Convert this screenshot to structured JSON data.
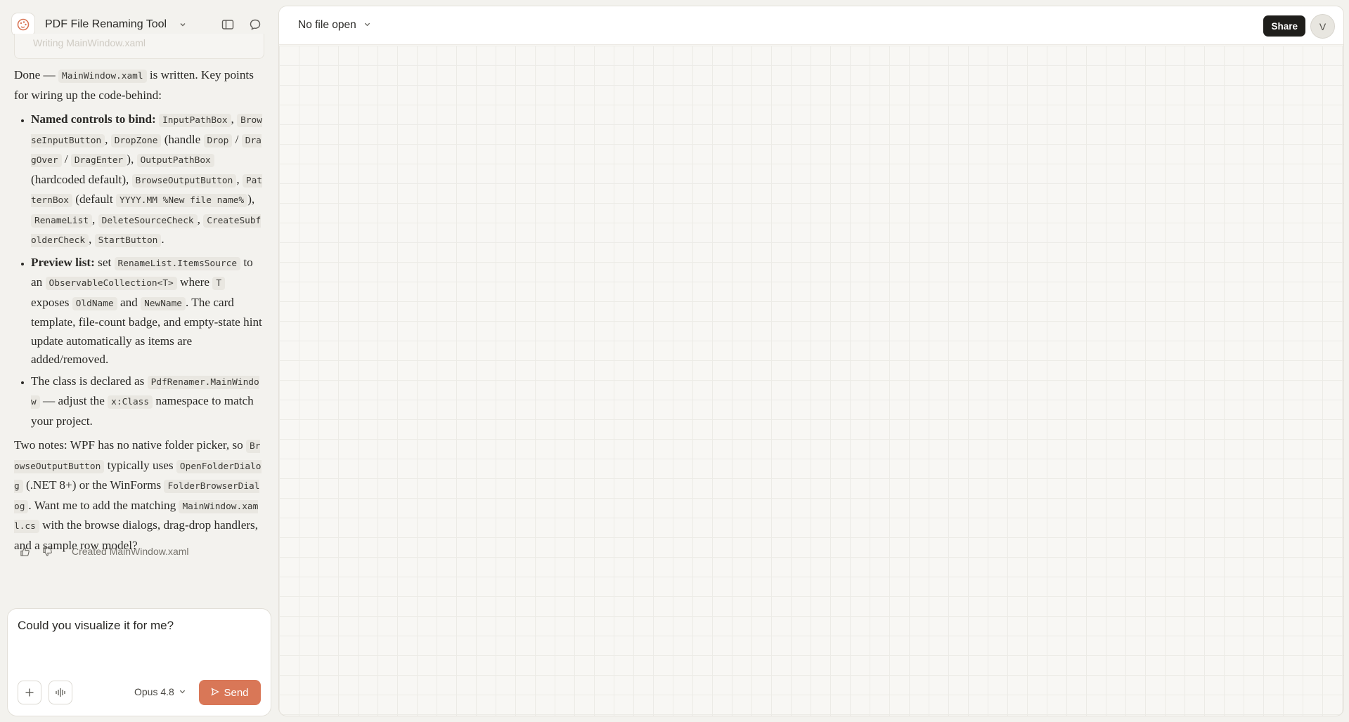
{
  "header": {
    "project_title": "PDF File Renaming Tool"
  },
  "faded_card": {
    "text": "Writing MainWindow.xaml"
  },
  "message": {
    "intro_before": "Done —",
    "intro_code": "MainWindow.xaml",
    "intro_after": "is written. Key points for wiring up the code-behind:",
    "b1": {
      "title": "Named controls to bind:",
      "c1": "InputPathBox",
      "s1": ",",
      "c2": "BrowseInputButton",
      "s2": ",",
      "c3": "DropZone",
      "t1": "(handle",
      "c4": "Drop",
      "t2": "/",
      "c5": "DragOver",
      "t3": "/",
      "c6": "DragEnter",
      "t4": "),",
      "c7": "OutputPathBox",
      "t5": "(hardcoded default),",
      "c8": "BrowseOutputButton",
      "s3": ",",
      "c9": "PatternBox",
      "t6": "(default",
      "c10": "YYYY.MM %New file name%",
      "t7": "),",
      "c11": "RenameList",
      "s4": ",",
      "c12": "DeleteSourceCheck",
      "s5": ",",
      "c13": "CreateSubfolderCheck",
      "s6": ",",
      "c14": "StartButton",
      "t8": "."
    },
    "b2": {
      "title": "Preview list:",
      "t1": "set",
      "c1": "RenameList.ItemsSource",
      "t2": "to an",
      "c2": "ObservableCollection<T>",
      "t3": "where",
      "c3": "T",
      "t4": "exposes",
      "c4": "OldName",
      "t5": "and",
      "c5": "NewName",
      "t6": ". The card template, file-count badge, and empty-state hint update automatically as items are added/removed."
    },
    "b3": {
      "t1": "The class is declared as",
      "c1": "PdfRenamer.MainWindow",
      "t2": "— adjust the",
      "c2": "x:Class",
      "t3": "namespace to match your project."
    },
    "outro": {
      "t1": "Two notes: WPF has no native folder picker, so",
      "c1": "BrowseOutputButton",
      "t2": "typically uses",
      "c2": "OpenFolderDialog",
      "t3": "(.NET 8+) or the WinForms",
      "c3": "FolderBrowserDialog",
      "t4": ". Want me to add the matching",
      "c4": "MainWindow.xaml.cs",
      "t5": "with the browse dialogs, drag-drop handlers, and a sample row model?"
    }
  },
  "feedback": {
    "created_label": "Created MainWindow.xaml"
  },
  "composer": {
    "input_value": "Could you visualize it for me?",
    "model_label": "Opus 4.8",
    "send_label": "Send"
  },
  "canvas": {
    "file_selector": "No file open",
    "share_label": "Share",
    "avatar_initial": "V"
  },
  "colors": {
    "accent": "#d97757",
    "page_bg": "#f3f2ee",
    "canvas_bg": "#f8f7f4",
    "share_bg": "#1f1e1b"
  },
  "icons": [
    "app-logo-icon",
    "chevron-down-icon",
    "sidebar-toggle-icon",
    "chat-icon",
    "thumbs-up-icon",
    "thumbs-down-icon",
    "plus-icon",
    "microphone-icon",
    "send-icon"
  ]
}
